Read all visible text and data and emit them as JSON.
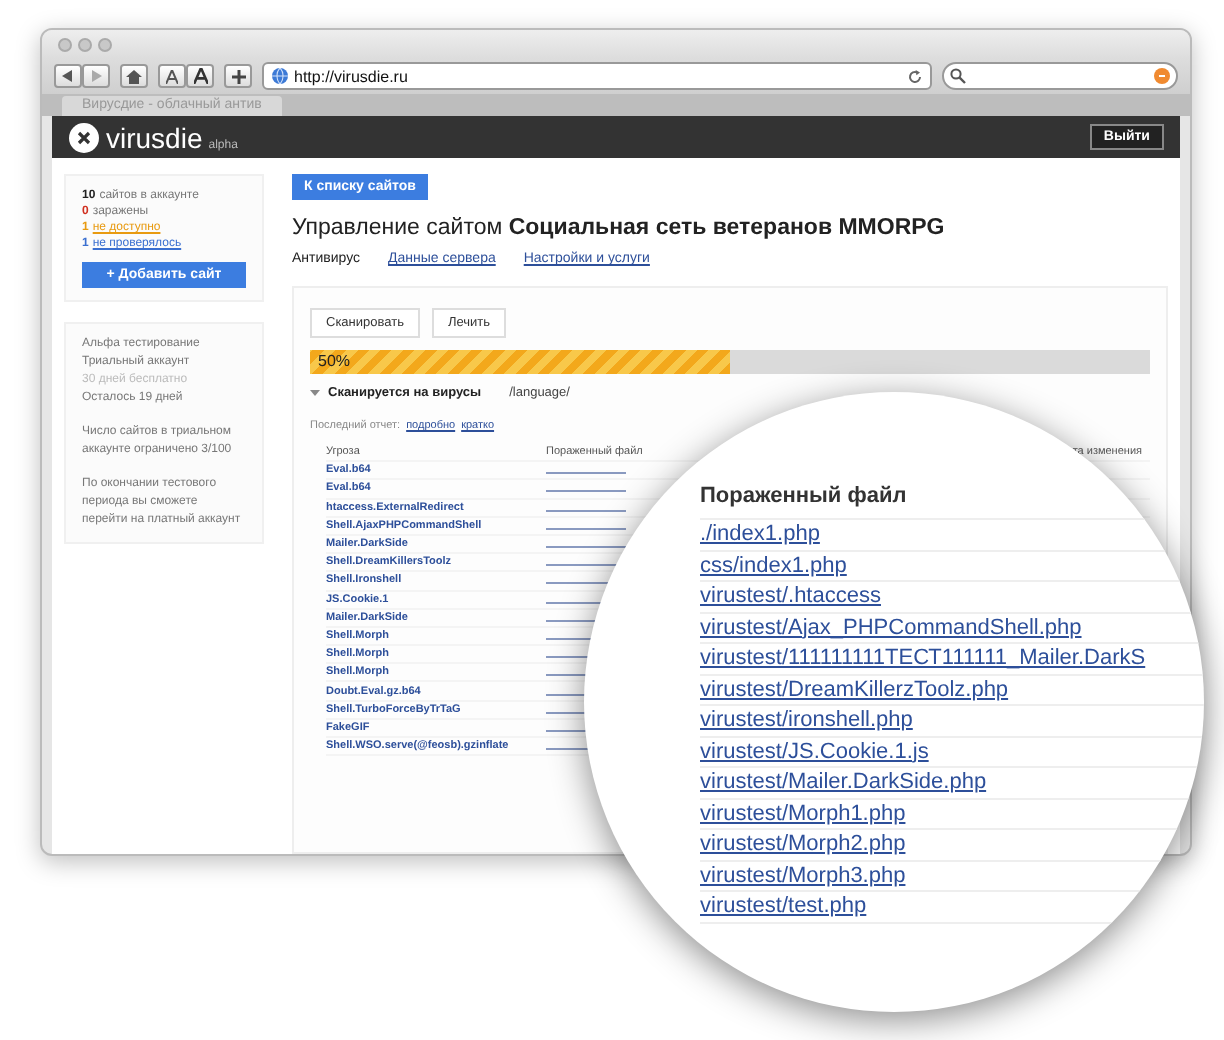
{
  "browser": {
    "url": "http://virusdie.ru",
    "tab_title": "Вирусдие - облачный антив"
  },
  "header": {
    "logo": "virusdie",
    "logo_badge": "alpha",
    "logout_button": "Выйти"
  },
  "sidebar": {
    "stats": [
      {
        "count": "10",
        "label": "сайтов в аккаунте",
        "color": "#222222",
        "link": false
      },
      {
        "count": "0",
        "label": "заражены",
        "color": "#d03020",
        "link": false
      },
      {
        "count": "1",
        "label": "не доступно",
        "color": "#e89a10",
        "link": true
      },
      {
        "count": "1",
        "label": "не проверялось",
        "color": "#3a6fd0",
        "link": true
      }
    ],
    "add_button": "+ Добавить сайт",
    "trial_lines": [
      {
        "text": "Альфа тестирование",
        "muted": false
      },
      {
        "text": "Триальный аккаунт",
        "muted": false
      },
      {
        "text": "30 дней бесплатно",
        "muted": true
      },
      {
        "text": "Осталось 19 дней",
        "muted": false
      }
    ],
    "notes": [
      "Число сайтов в триальном аккаунте ограничено 3/100",
      "По окончании тестового периода вы сможете перейти на платный аккаунт"
    ]
  },
  "main": {
    "back_button": "К списку сайтов",
    "title_prefix": "Управление сайтом",
    "title_site": "Социальная сеть ветеранов MMORPG",
    "tabs": [
      {
        "label": "Антивирус",
        "selected": true
      },
      {
        "label": "Данные сервера",
        "selected": false
      },
      {
        "label": "Настройки и услуги",
        "selected": false
      }
    ],
    "actions": [
      "Сканировать",
      "Лечить"
    ],
    "progress": {
      "label": "50%",
      "level": 0.5
    },
    "status": {
      "text": "Сканируется на вирусы",
      "path": "/language/"
    },
    "report": {
      "label": "Последний отчет:",
      "links": [
        "подробно",
        "кратко"
      ]
    },
    "table": {
      "columns": [
        "Угроза",
        "Пораженный файл",
        "та изменения"
      ],
      "threats": [
        "Eval.b64",
        "Eval.b64",
        "htaccess.ExternalRedirect",
        "Shell.AjaxPHPCommandShell",
        "Mailer.DarkSide",
        "Shell.DreamKillersToolz",
        "Shell.Ironshell",
        "JS.Cookie.1",
        "Mailer.DarkSide",
        "Shell.Morph",
        "Shell.Morph",
        "Shell.Morph",
        "Doubt.Eval.gz.b64",
        "Shell.TurboForceByTrTaG",
        "FakeGIF",
        "Shell.WSO.serve(@feosb).gzinflate"
      ]
    }
  },
  "magnifier": {
    "heading": "Пораженный файл",
    "files": [
      "./index1.php",
      "css/index1.php",
      "virustest/.htaccess",
      "virustest/Ajax_PHPCommandShell.php",
      "virustest/111111111ТЕСТ111111_Mailer.DarkS",
      "virustest/DreamKillerzToolz.php",
      "virustest/ironshell.php",
      "virustest/JS.Cookie.1.js",
      "virustest/Mailer.DarkSide.php",
      "virustest/Morph1.php",
      "virustest/Morph2.php",
      "virustest/Morph3.php",
      "virustest/test.php"
    ]
  }
}
